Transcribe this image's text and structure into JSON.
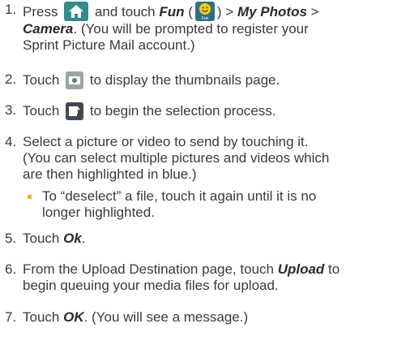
{
  "steps": [
    {
      "num": "1.",
      "a": "Press",
      "b": "and touch",
      "fun": "Fun",
      "c": "(",
      "d": ") >",
      "myphotos": "My Photos",
      "e": ">",
      "camera": "Camera",
      "f": ". (You will be prompted to register your",
      "g": "Sprint Picture Mail account.)"
    },
    {
      "num": "2.",
      "a": "Touch",
      "b": "to display the thumbnails page."
    },
    {
      "num": "3.",
      "a": "Touch",
      "b": "to begin the selection process."
    },
    {
      "num": "4.",
      "line1": "Select a picture or video to send by touching it.",
      "line2": "(You can select multiple pictures and videos which",
      "line3": "are then highlighted in blue.)"
    },
    {
      "num": "5.",
      "a": "Touch",
      "ok": "Ok",
      "b": "."
    },
    {
      "num": "6.",
      "a": "From the Upload Destination page, touch",
      "upload": "Upload",
      "b": "to",
      "line2": "begin queuing your media files for upload."
    },
    {
      "num": "7.",
      "a": "Touch",
      "ok": "OK",
      "b": ". (You will see a message.)"
    }
  ],
  "bullet": {
    "line1": "To “deselect” a file, touch it again until it is no",
    "line2": "longer highlighted."
  },
  "fun_icon_label": "Fun",
  "colors": {
    "accent": "#f2b705",
    "home_icon_bg": "#2d8e8a",
    "text": "#3a3a3a"
  }
}
